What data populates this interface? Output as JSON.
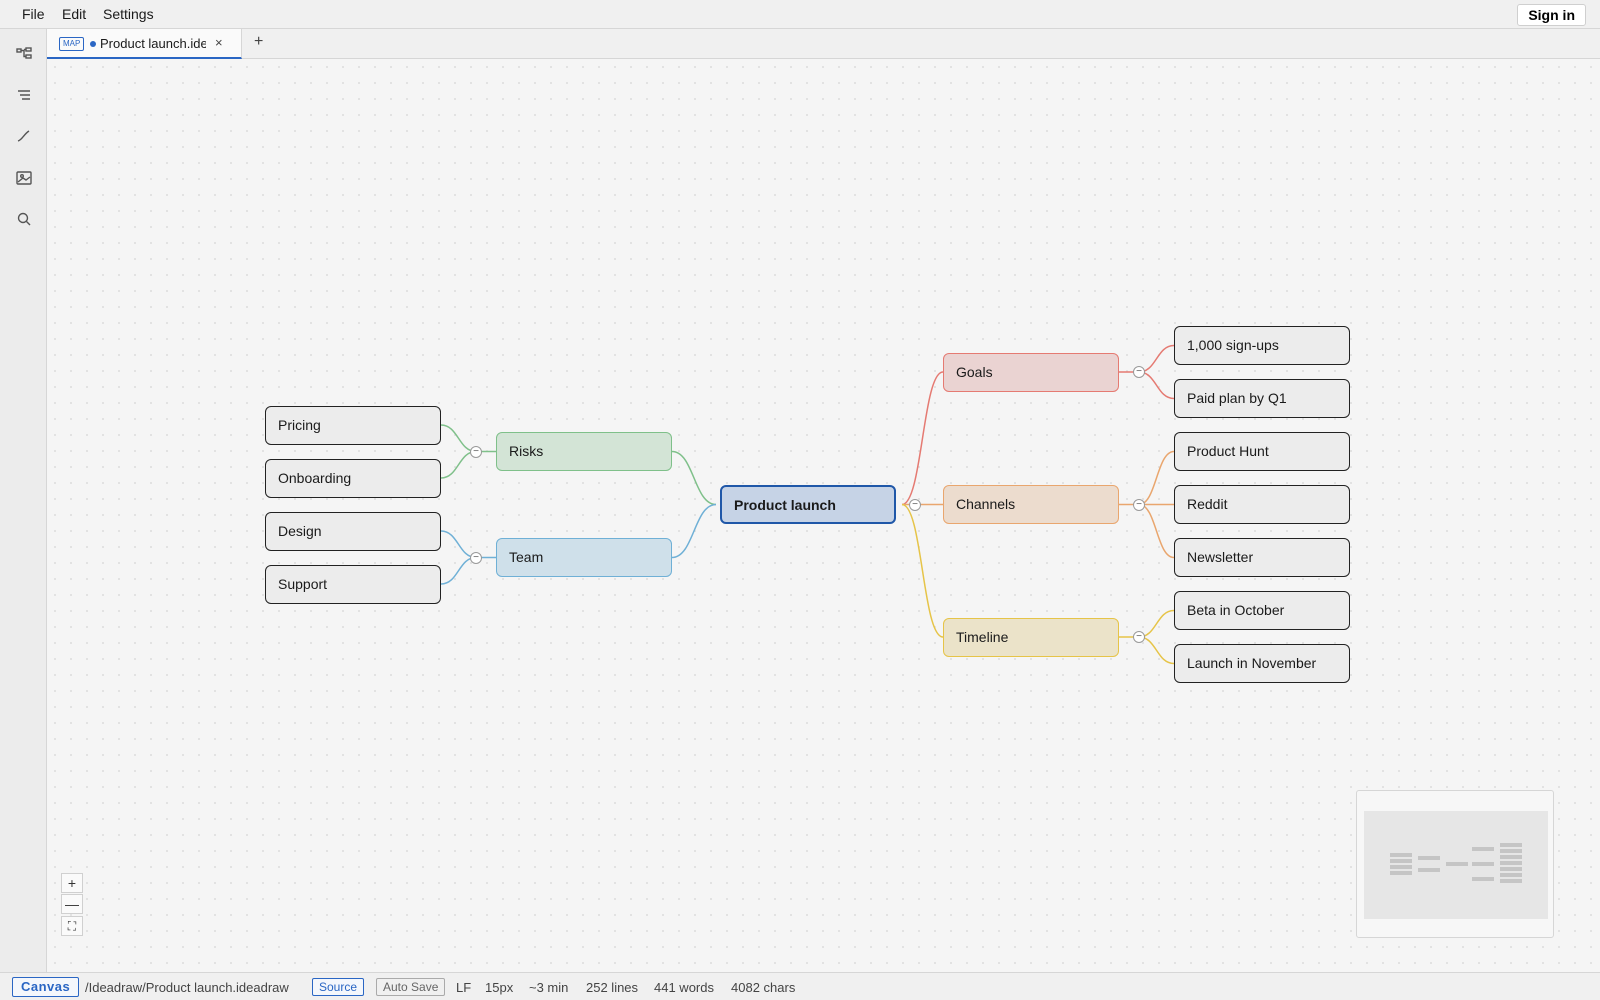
{
  "menu": {
    "file": "File",
    "edit": "Edit",
    "settings": "Settings",
    "sign_in": "Sign in"
  },
  "activity_icons": [
    "mindmap-icon",
    "outline-icon",
    "pen-icon",
    "image-icon",
    "search-icon"
  ],
  "tab": {
    "badge": "MAP",
    "title": "Product launch.ideadraw",
    "close": "×",
    "add": "+"
  },
  "map": {
    "root": "Product launch",
    "right": [
      {
        "label": "Goals",
        "color": "#e57a72",
        "children": [
          "1,000 sign-ups",
          "Paid plan by Q1"
        ]
      },
      {
        "label": "Channels",
        "color": "#e9a66e",
        "children": [
          "Product Hunt",
          "Reddit",
          "Newsletter"
        ]
      },
      {
        "label": "Timeline",
        "color": "#e6c448",
        "children": [
          "Beta in October",
          "Launch in November"
        ]
      }
    ],
    "left": [
      {
        "label": "Risks",
        "color": "#7fc08a",
        "children": [
          "Pricing",
          "Onboarding"
        ]
      },
      {
        "label": "Team",
        "color": "#6fb0d6",
        "children": [
          "Design",
          "Support"
        ]
      }
    ],
    "collapse_symbol": "−"
  },
  "zoom": {
    "in": "+",
    "out": "—",
    "fit": "⛶"
  },
  "status": {
    "mode": "Canvas",
    "path": "/Ideadraw/Product launch.ideadraw",
    "source": "Source",
    "auto_save": "Auto Save",
    "line_ending": "LF",
    "font_size": "15px",
    "read_time": "~3 min",
    "lines": "252 lines",
    "words": "441 words",
    "chars": "4082 chars"
  }
}
